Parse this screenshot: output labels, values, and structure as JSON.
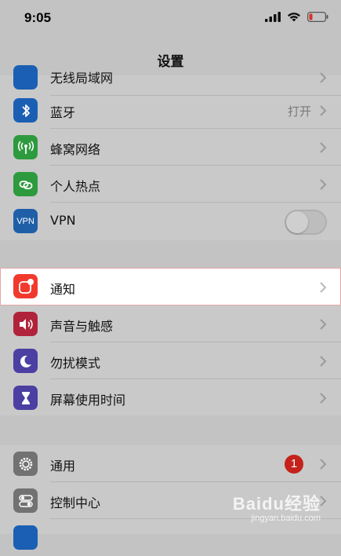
{
  "status": {
    "time": "9:05"
  },
  "nav": {
    "title": "设置"
  },
  "group1": {
    "partial_label": "无线局域网",
    "items": [
      {
        "label": "蓝牙",
        "value": "打开"
      },
      {
        "label": "蜂窝网络"
      },
      {
        "label": "个人热点"
      },
      {
        "label": "VPN",
        "icon_text": "VPN"
      }
    ]
  },
  "group2": {
    "items": [
      {
        "label": "通知"
      },
      {
        "label": "声音与触感"
      },
      {
        "label": "勿扰模式"
      },
      {
        "label": "屏幕使用时间"
      }
    ]
  },
  "group3": {
    "items": [
      {
        "label": "通用",
        "badge": "1"
      },
      {
        "label": "控制中心"
      }
    ]
  },
  "watermark": {
    "main": "Baidu经验",
    "sub": "jingyan.baidu.com"
  },
  "colors": {
    "bluetooth": "#1a5fb4",
    "cellular": "#2e9a3e",
    "hotspot": "#2e9a3e",
    "vpn": "#1f5fa8",
    "notify": "#f2392e",
    "sound": "#b1233a",
    "dnd": "#4b3fa2",
    "screentime": "#4b3fa2",
    "general": "#727272",
    "control": "#727272",
    "badge": "#c4221b"
  }
}
